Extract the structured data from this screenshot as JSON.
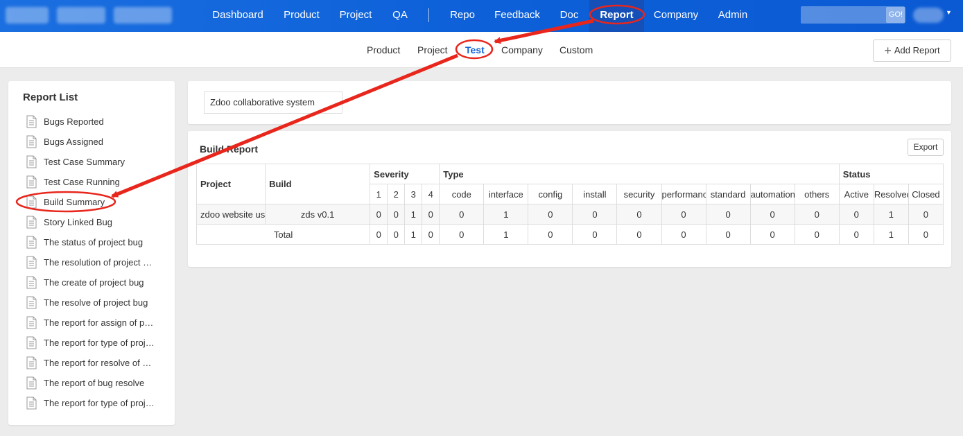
{
  "topnav": {
    "items": [
      {
        "label": "Dashboard"
      },
      {
        "label": "Product"
      },
      {
        "label": "Project"
      },
      {
        "label": "QA"
      },
      {
        "label": "Repo"
      },
      {
        "label": "Feedback"
      },
      {
        "label": "Doc"
      },
      {
        "label": "Report"
      },
      {
        "label": "Company"
      },
      {
        "label": "Admin"
      }
    ],
    "active": "Report",
    "search_go": "GO!"
  },
  "subnav": {
    "items": [
      {
        "label": "Product"
      },
      {
        "label": "Project"
      },
      {
        "label": "Test"
      },
      {
        "label": "Company"
      },
      {
        "label": "Custom"
      }
    ],
    "active": "Test",
    "add_report": "Add Report"
  },
  "sidebar": {
    "title": "Report List",
    "items": [
      {
        "label": "Bugs Reported"
      },
      {
        "label": "Bugs Assigned"
      },
      {
        "label": "Test Case Summary"
      },
      {
        "label": "Test Case Running"
      },
      {
        "label": "Build Summary"
      },
      {
        "label": "Story Linked Bug"
      },
      {
        "label": "The status of project bug"
      },
      {
        "label": "The resolution of project bug"
      },
      {
        "label": "The create of project bug"
      },
      {
        "label": "The resolve of project bug"
      },
      {
        "label": "The report for assign of project bug"
      },
      {
        "label": "The report for type of project bug"
      },
      {
        "label": "The report for resolve of project bug"
      },
      {
        "label": "The report of bug resolve"
      },
      {
        "label": "The report for type of project bug"
      }
    ],
    "active": "Build Summary"
  },
  "product_select": {
    "value": "Zdoo collaborative system"
  },
  "report": {
    "title": "Build Report",
    "export": "Export",
    "headers": {
      "project": "Project",
      "build": "Build",
      "severity": "Severity",
      "type": "Type",
      "status": "Status",
      "severity_cols": [
        "1",
        "2",
        "3",
        "4"
      ],
      "type_cols": [
        "code",
        "interface",
        "config",
        "install",
        "security",
        "performance",
        "standard",
        "automation",
        "others"
      ],
      "status_cols": [
        "Active",
        "Resolved",
        "Closed"
      ]
    },
    "rows": [
      {
        "project": "zdoo website use",
        "build": "zds v0.1",
        "severity": [
          "0",
          "0",
          "1",
          "0"
        ],
        "type": [
          "0",
          "1",
          "0",
          "0",
          "0",
          "0",
          "0",
          "0",
          "0"
        ],
        "status": [
          "0",
          "1",
          "0"
        ]
      }
    ],
    "total": {
      "label": "Total",
      "severity": [
        "0",
        "0",
        "1",
        "0"
      ],
      "type": [
        "0",
        "1",
        "0",
        "0",
        "0",
        "0",
        "0",
        "0",
        "0"
      ],
      "status": [
        "0",
        "1",
        "0"
      ]
    }
  },
  "colors": {
    "topbar": "#0d60d8",
    "active_link": "#1565d8",
    "annotation": "#e8261c"
  }
}
